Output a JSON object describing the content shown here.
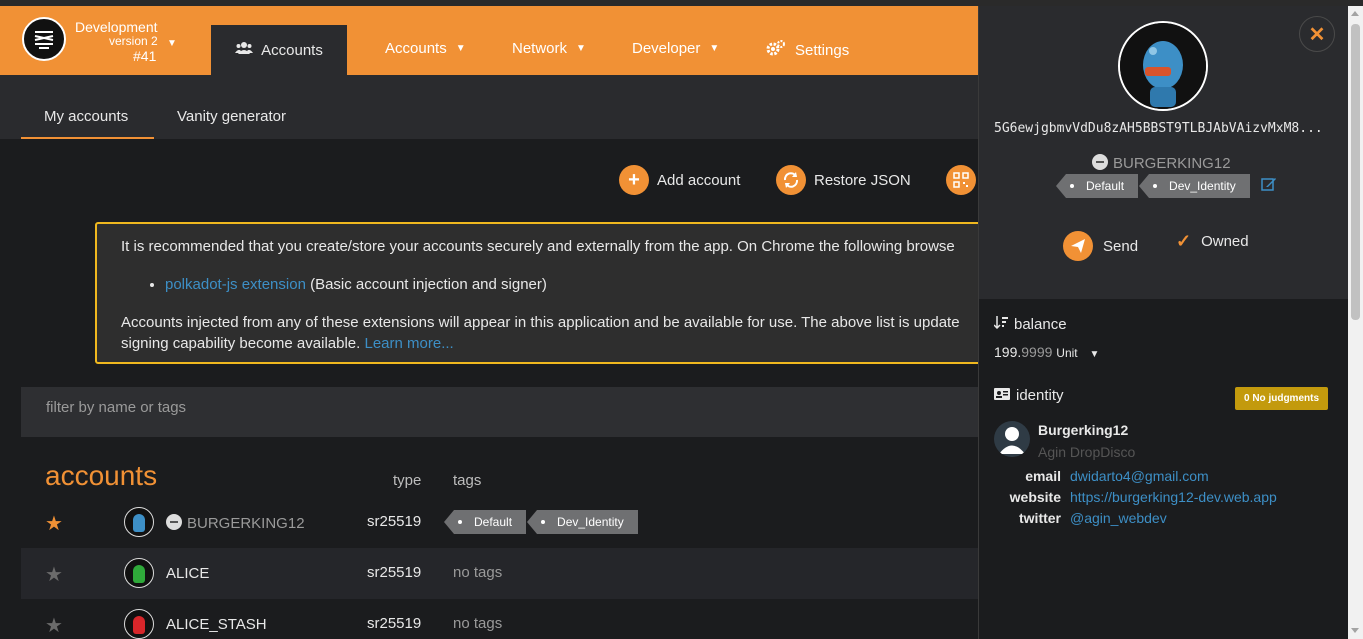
{
  "header": {
    "chain_name": "Development",
    "chain_version": "version 2",
    "block": "#41",
    "nav_active": "Accounts",
    "nav": [
      "Accounts",
      "Network",
      "Developer",
      "Settings"
    ]
  },
  "subtabs": [
    "My accounts",
    "Vanity generator"
  ],
  "actions": {
    "add": "Add account",
    "restore": "Restore JSON"
  },
  "warning": {
    "line1": "It is recommended that you create/store your accounts securely and externally from the app. On Chrome the following browse",
    "ext_link": "polkadot-js extension",
    "ext_desc": "(Basic account injection and signer)",
    "line2": "Accounts injected from any of these extensions will appear in this application and be available for use. The above list is update",
    "line3": "signing capability become available.",
    "learn_more": "Learn more..."
  },
  "filter_placeholder": "filter by name or tags",
  "table": {
    "title": "accounts",
    "col_type": "type",
    "col_tags": "tags",
    "rows": [
      {
        "name": "BURGERKING12",
        "type": "sr25519",
        "tags": [
          "Default",
          "Dev_Identity"
        ],
        "starred": true
      },
      {
        "name": "ALICE",
        "type": "sr25519",
        "no_tags": "no tags",
        "starred": false
      },
      {
        "name": "ALICE_STASH",
        "type": "sr25519",
        "no_tags": "no tags",
        "starred": false
      }
    ]
  },
  "sidebar": {
    "address": "5G6ewjgbmvVdDu8zAH5BBST9TLBJAbVAizvMxM8...",
    "name": "BURGERKING12",
    "tags": [
      "Default",
      "Dev_Identity"
    ],
    "send": "Send",
    "owned": "Owned",
    "balance_label": "balance",
    "balance_int": "199.",
    "balance_dec": "9999",
    "balance_unit": "Unit",
    "identity_label": "identity",
    "judgment_badge": "0 No judgments",
    "display_name": "Burgerking12",
    "legal_name": "Agin DropDisco",
    "email_label": "email",
    "email": "dwidarto4@gmail.com",
    "website_label": "website",
    "website": "https://burgerking12-dev.web.app",
    "twitter_label": "twitter",
    "twitter": "@agin_webdev"
  },
  "colors": {
    "accent": "#f19135",
    "link": "#3d8fc6",
    "badge": "#c39a0d"
  }
}
